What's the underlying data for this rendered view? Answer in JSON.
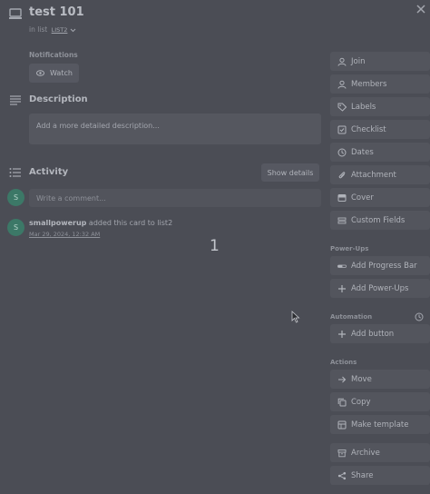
{
  "header": {
    "title": "test 101",
    "in_list_label": "in list",
    "list_name": "LIST2"
  },
  "notifications": {
    "label": "Notifications",
    "watch_label": "Watch"
  },
  "description": {
    "title": "Description",
    "placeholder": "Add a more detailed description..."
  },
  "activity": {
    "title": "Activity",
    "show_details_label": "Show details",
    "comment_avatar": "S",
    "comment_placeholder": "Write a comment...",
    "entries": [
      {
        "avatar": "S",
        "user": "smallpowerup",
        "action": " added this card to list2",
        "timestamp": "Mar 29, 2024, 12:32 AM"
      }
    ]
  },
  "overlay": {
    "number": "1"
  },
  "sidebar": {
    "add_to_card": [
      {
        "label": "Join",
        "icon": "user-icon"
      },
      {
        "label": "Members",
        "icon": "user-icon"
      },
      {
        "label": "Labels",
        "icon": "tag-icon"
      },
      {
        "label": "Checklist",
        "icon": "checklist-icon"
      },
      {
        "label": "Dates",
        "icon": "clock-icon"
      },
      {
        "label": "Attachment",
        "icon": "paperclip-icon"
      },
      {
        "label": "Cover",
        "icon": "cover-icon"
      },
      {
        "label": "Custom Fields",
        "icon": "custom-fields-icon"
      }
    ],
    "power_ups_label": "Power-Ups",
    "power_ups": [
      {
        "label": "Add Progress Bar",
        "icon": "progress-bar-icon"
      },
      {
        "label": "Add Power-Ups",
        "icon": "plus-icon"
      }
    ],
    "automation_label": "Automation",
    "automation": [
      {
        "label": "Add button",
        "icon": "plus-icon"
      }
    ],
    "actions_label": "Actions",
    "actions": [
      {
        "label": "Move",
        "icon": "arrow-right-icon"
      },
      {
        "label": "Copy",
        "icon": "copy-icon"
      },
      {
        "label": "Make template",
        "icon": "template-icon"
      },
      {
        "label": "Archive",
        "icon": "archive-icon"
      },
      {
        "label": "Share",
        "icon": "share-icon"
      }
    ]
  }
}
